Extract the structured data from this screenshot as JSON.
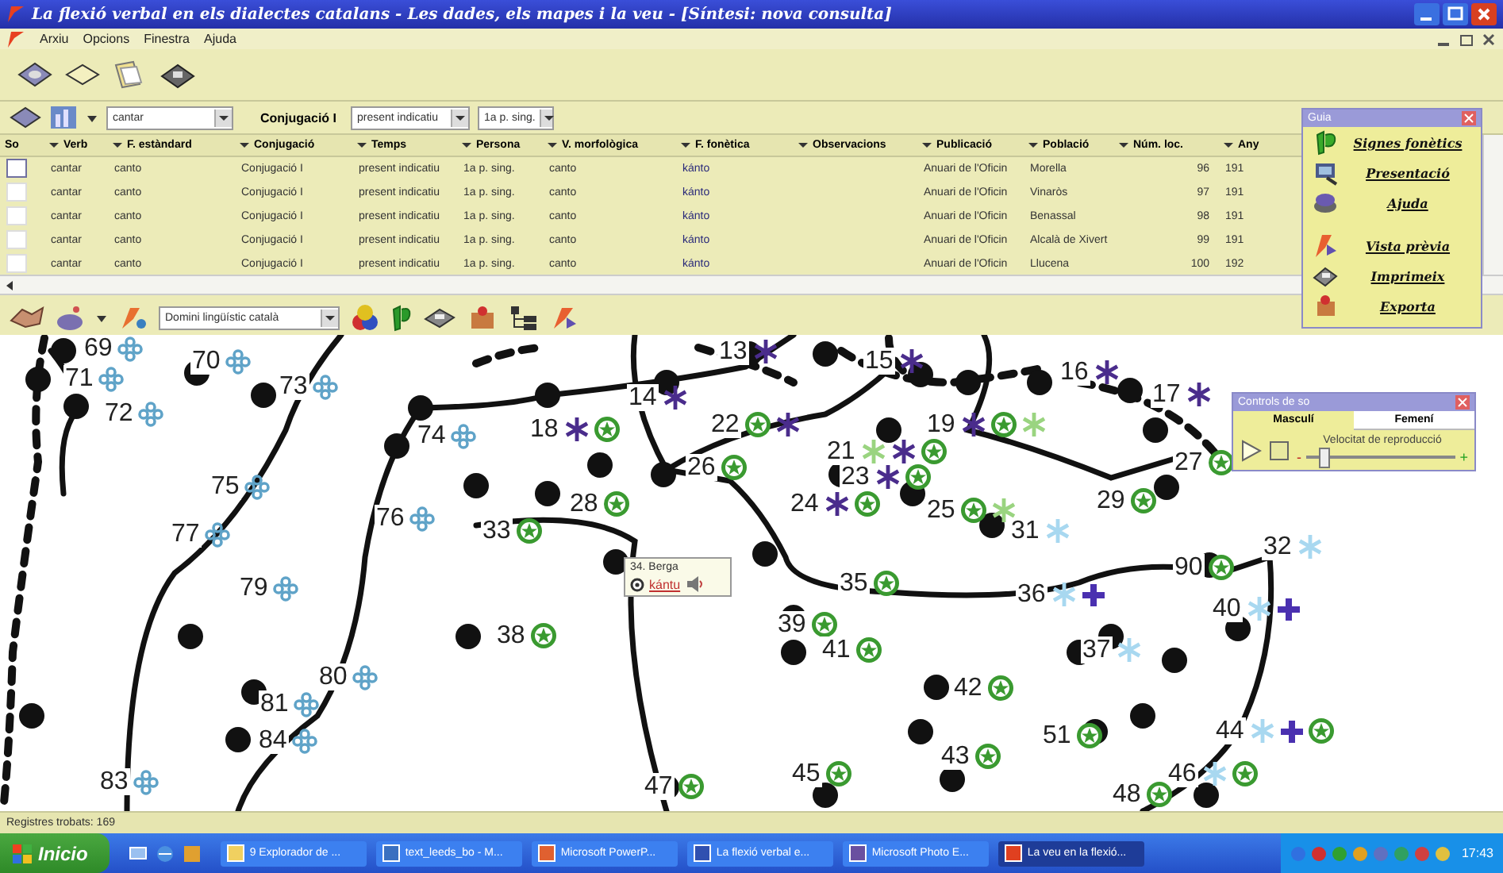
{
  "window": {
    "title": "La flexió verbal en els dialectes catalans - Les dades, els mapes i la veu - [Síntesi: nova consulta]",
    "menu": [
      "Arxiu",
      "Opcions",
      "Finestra",
      "Ajuda"
    ]
  },
  "query": {
    "verb": "cantar",
    "conjugation": "Conjugació I",
    "tense": "present indicatiu",
    "person": "1a p. sing."
  },
  "table": {
    "columns": [
      "So",
      "Verb",
      "F. estàndard",
      "Conjugació",
      "Temps",
      "Persona",
      "V. morfològica",
      "F. fonètica",
      "Observacions",
      "Publicació",
      "Població",
      "Núm. loc.",
      "Any"
    ],
    "rows": [
      {
        "selected": true,
        "cells": {
          "verb": "cantar",
          "standard": "canto",
          "conjugation": "Conjugació I",
          "tense": "present indicatiu",
          "person": "1a p. sing.",
          "morph": "canto",
          "phonetic": "kánto",
          "publication": "Anuari de l'Oficin",
          "town": "Morella",
          "number": "96",
          "year": "191"
        }
      },
      {
        "selected": false,
        "cells": {
          "verb": "cantar",
          "standard": "canto",
          "conjugation": "Conjugació I",
          "tense": "present indicatiu",
          "person": "1a p. sing.",
          "morph": "canto",
          "phonetic": "kánto",
          "publication": "Anuari de l'Oficin",
          "town": "Vinaròs",
          "number": "97",
          "year": "191"
        }
      },
      {
        "selected": false,
        "cells": {
          "verb": "cantar",
          "standard": "canto",
          "conjugation": "Conjugació I",
          "tense": "present indicatiu",
          "person": "1a p. sing.",
          "morph": "canto",
          "phonetic": "kánto",
          "publication": "Anuari de l'Oficin",
          "town": "Benassal",
          "number": "98",
          "year": "191"
        }
      },
      {
        "selected": false,
        "cells": {
          "verb": "cantar",
          "standard": "canto",
          "conjugation": "Conjugació I",
          "tense": "present indicatiu",
          "person": "1a p. sing.",
          "morph": "canto",
          "phonetic": "kánto",
          "publication": "Anuari de l'Oficin",
          "town": "Alcalà de Xivert",
          "number": "99",
          "year": "191"
        }
      },
      {
        "selected": false,
        "cells": {
          "verb": "cantar",
          "standard": "canto",
          "conjugation": "Conjugació I",
          "tense": "present indicatiu",
          "person": "1a p. sing.",
          "morph": "canto",
          "phonetic": "kánto",
          "publication": "Anuari de l'Oficin",
          "town": "Llucena",
          "number": "100",
          "year": "192"
        }
      }
    ]
  },
  "map_toolbar": {
    "domain": "Domini lingüístic català"
  },
  "map": {
    "locations": [
      {
        "label": "69",
        "markers": [
          {
            "kind": "flower",
            "color": "#5fa3c8"
          }
        ]
      },
      {
        "label": "71",
        "markers": [
          {
            "kind": "flower",
            "color": "#5fa3c8"
          }
        ]
      },
      {
        "label": "72",
        "markers": [
          {
            "kind": "flower",
            "color": "#5fa3c8"
          }
        ]
      },
      {
        "label": "70",
        "markers": [
          {
            "kind": "flower",
            "color": "#5fa3c8"
          }
        ]
      },
      {
        "label": "73",
        "markers": [
          {
            "kind": "flower",
            "color": "#5fa3c8"
          }
        ]
      },
      {
        "label": "74",
        "markers": [
          {
            "kind": "flower",
            "color": "#5fa3c8"
          }
        ]
      },
      {
        "label": "75",
        "markers": [
          {
            "kind": "flower",
            "color": "#5fa3c8"
          }
        ]
      },
      {
        "label": "77",
        "markers": [
          {
            "kind": "flower",
            "color": "#5fa3c8"
          }
        ]
      },
      {
        "label": "76",
        "markers": [
          {
            "kind": "flower",
            "color": "#5fa3c8"
          }
        ]
      },
      {
        "label": "79",
        "markers": [
          {
            "kind": "flower",
            "color": "#5fa3c8"
          }
        ]
      },
      {
        "label": "80",
        "markers": [
          {
            "kind": "flower",
            "color": "#5fa3c8"
          }
        ]
      },
      {
        "label": "81",
        "markers": [
          {
            "kind": "flower",
            "color": "#5fa3c8"
          }
        ]
      },
      {
        "label": "84",
        "markers": [
          {
            "kind": "flower",
            "color": "#5fa3c8"
          }
        ]
      },
      {
        "label": "83",
        "markers": [
          {
            "kind": "flower",
            "color": "#5fa3c8"
          }
        ]
      },
      {
        "label": "18",
        "markers": [
          {
            "kind": "asterisk",
            "color": "#4a2c8c"
          },
          {
            "kind": "star"
          }
        ]
      },
      {
        "label": "14",
        "markers": [
          {
            "kind": "asterisk",
            "color": "#4a2c8c"
          }
        ]
      },
      {
        "label": "22",
        "markers": [
          {
            "kind": "star"
          },
          {
            "kind": "asterisk",
            "color": "#4a2c8c"
          }
        ]
      },
      {
        "label": "26",
        "markers": [
          {
            "kind": "star"
          }
        ]
      },
      {
        "label": "28",
        "markers": [
          {
            "kind": "star"
          }
        ]
      },
      {
        "label": "33",
        "markers": [
          {
            "kind": "star"
          }
        ]
      },
      {
        "label": "13",
        "markers": [
          {
            "kind": "asterisk",
            "color": "#4a2c8c"
          }
        ]
      },
      {
        "label": "15",
        "markers": [
          {
            "kind": "asterisk",
            "color": "#4a2c8c"
          }
        ]
      },
      {
        "label": "19",
        "markers": [
          {
            "kind": "asterisk",
            "color": "#4a2c8c"
          },
          {
            "kind": "star"
          },
          {
            "kind": "asterisk",
            "color": "#9ad480"
          }
        ]
      },
      {
        "label": "21",
        "markers": [
          {
            "kind": "asterisk",
            "color": "#9ad480"
          },
          {
            "kind": "asterisk",
            "color": "#4a2c8c"
          },
          {
            "kind": "star"
          }
        ]
      },
      {
        "label": "23",
        "markers": [
          {
            "kind": "asterisk",
            "color": "#4a2c8c"
          },
          {
            "kind": "star"
          }
        ]
      },
      {
        "label": "24",
        "markers": [
          {
            "kind": "asterisk",
            "color": "#4a2c8c"
          },
          {
            "kind": "star"
          }
        ]
      },
      {
        "label": "25",
        "markers": [
          {
            "kind": "star"
          },
          {
            "kind": "asterisk",
            "color": "#9ad480"
          }
        ]
      },
      {
        "label": "16",
        "markers": [
          {
            "kind": "asterisk",
            "color": "#4a2c8c"
          }
        ]
      },
      {
        "label": "17",
        "markers": [
          {
            "kind": "asterisk",
            "color": "#4a2c8c"
          }
        ]
      },
      {
        "label": "27",
        "markers": [
          {
            "kind": "star"
          }
        ]
      },
      {
        "label": "29",
        "markers": [
          {
            "kind": "star"
          }
        ]
      },
      {
        "label": "31",
        "markers": [
          {
            "kind": "asterisk",
            "color": "#a8d8f0"
          }
        ]
      },
      {
        "label": "32",
        "markers": [
          {
            "kind": "asterisk",
            "color": "#a8d8f0"
          }
        ]
      },
      {
        "label": "90",
        "markers": [
          {
            "kind": "star"
          }
        ]
      },
      {
        "label": "35",
        "markers": [
          {
            "kind": "star"
          }
        ]
      },
      {
        "label": "36",
        "markers": [
          {
            "kind": "asterisk",
            "color": "#a8d8f0"
          },
          {
            "kind": "cross"
          }
        ]
      },
      {
        "label": "40",
        "markers": [
          {
            "kind": "asterisk",
            "color": "#a8d8f0"
          },
          {
            "kind": "cross"
          }
        ]
      },
      {
        "label": "37",
        "markers": [
          {
            "kind": "asterisk",
            "color": "#a8d8f0"
          }
        ]
      },
      {
        "label": "38",
        "markers": [
          {
            "kind": "star"
          }
        ]
      },
      {
        "label": "39",
        "markers": [
          {
            "kind": "star"
          }
        ]
      },
      {
        "label": "41",
        "markers": [
          {
            "kind": "star"
          }
        ]
      },
      {
        "label": "42",
        "markers": [
          {
            "kind": "star"
          }
        ]
      },
      {
        "label": "51",
        "markers": [
          {
            "kind": "star"
          }
        ]
      },
      {
        "label": "43",
        "markers": [
          {
            "kind": "star"
          }
        ]
      },
      {
        "label": "44",
        "markers": [
          {
            "kind": "asterisk",
            "color": "#a8d8f0"
          },
          {
            "kind": "cross"
          },
          {
            "kind": "star"
          }
        ]
      },
      {
        "label": "45",
        "markers": [
          {
            "kind": "star"
          }
        ]
      },
      {
        "label": "46",
        "markers": [
          {
            "kind": "asterisk",
            "color": "#a8d8f0"
          },
          {
            "kind": "star"
          }
        ]
      },
      {
        "label": "47",
        "markers": [
          {
            "kind": "star"
          }
        ]
      },
      {
        "label": "48",
        "markers": [
          {
            "kind": "star"
          }
        ]
      }
    ],
    "popup": {
      "title": "34. Berga",
      "link": "kántu"
    }
  },
  "guide": {
    "title": "Guia",
    "items": [
      "Signes fonètics",
      "Presentació",
      "Ajuda",
      "Vista prèvia",
      "Imprimeix",
      "Exporta"
    ]
  },
  "sound_controls": {
    "title": "Controls de so",
    "tabs": [
      {
        "label": "Masculí",
        "selected": true
      },
      {
        "label": "Femení",
        "selected": false
      }
    ],
    "speed_label": "Velocitat de reproducció",
    "minus": "-",
    "plus": "+",
    "level": 0.12
  },
  "status_bar": "Registres trobats: 169",
  "taskbar": {
    "start": "Inicio",
    "tasks": [
      {
        "label": "9 Explorador de ...",
        "selected": false
      },
      {
        "label": "text_leeds_bo - M...",
        "selected": false
      },
      {
        "label": "Microsoft PowerP...",
        "selected": false
      },
      {
        "label": "La flexió verbal e...",
        "selected": false
      },
      {
        "label": "Microsoft Photo E...",
        "selected": false
      },
      {
        "label": "La veu en la flexió...",
        "selected": true
      }
    ],
    "clock": "17:43"
  }
}
